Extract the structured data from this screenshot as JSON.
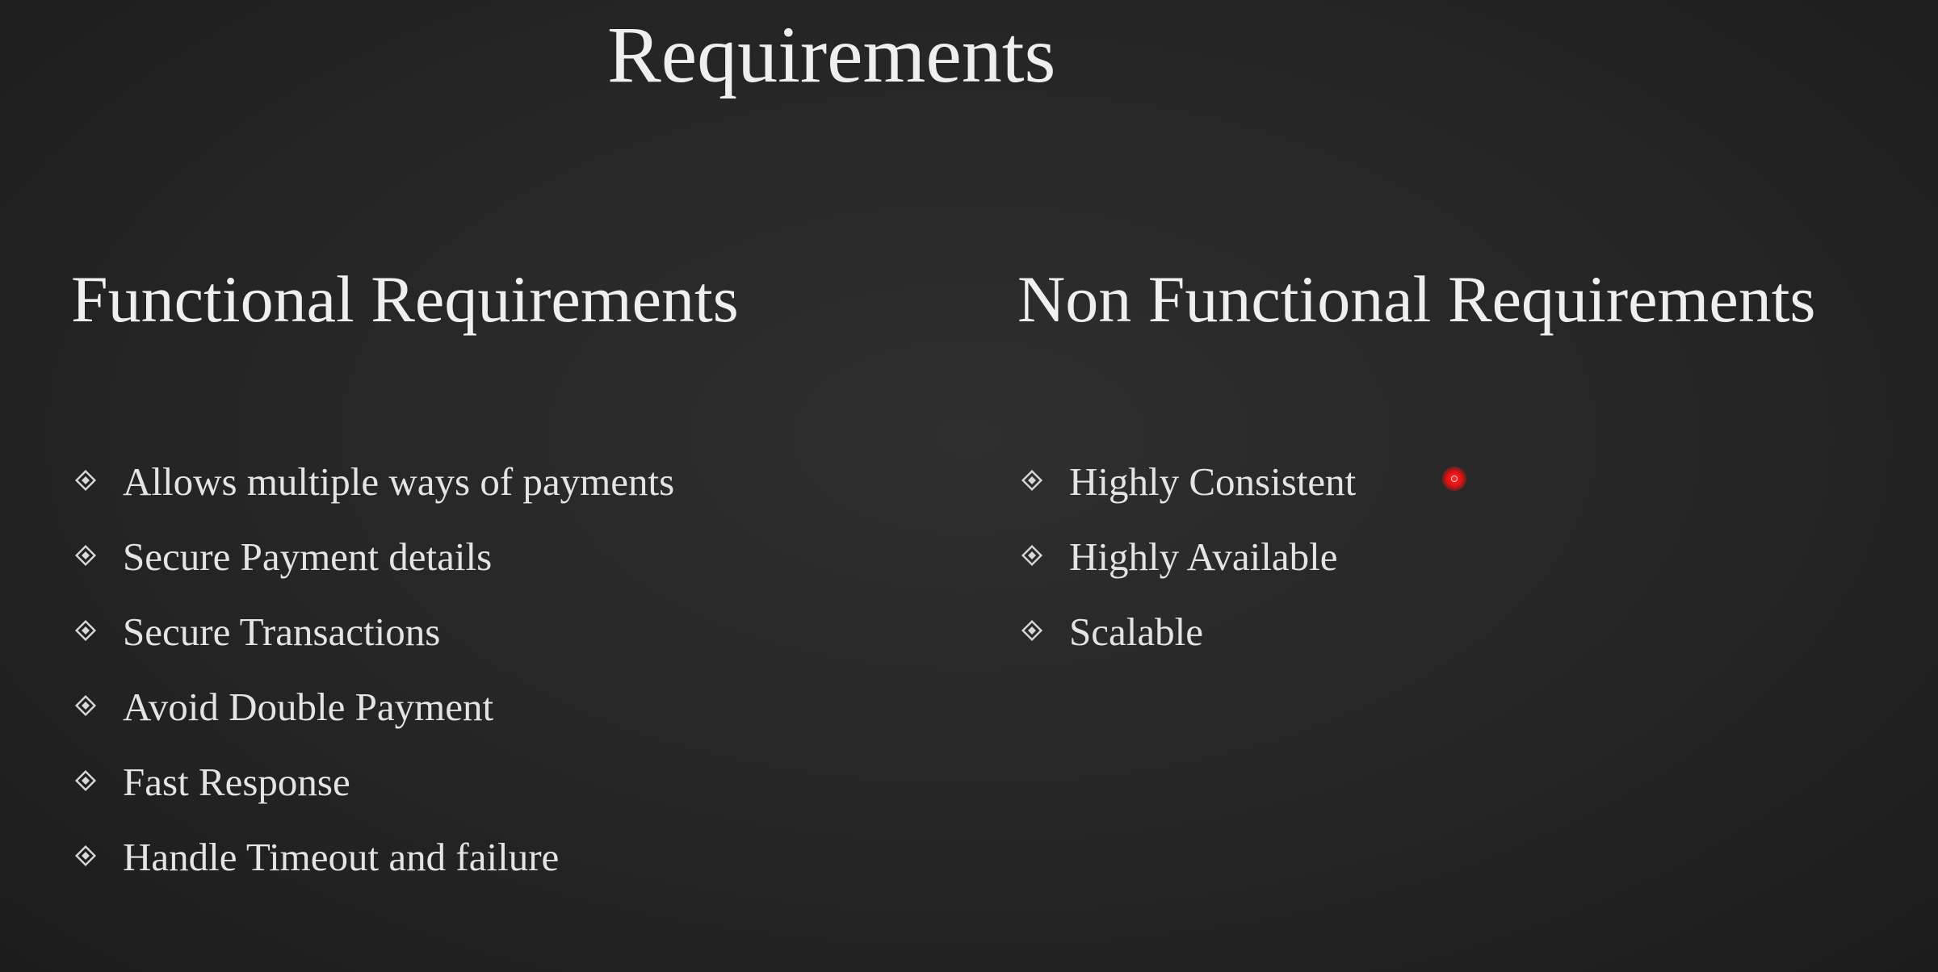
{
  "slide": {
    "title": "Requirements",
    "functional": {
      "heading": "Functional Requirements",
      "items": [
        "Allows multiple ways of payments",
        "Secure Payment details",
        "Secure Transactions",
        "Avoid Double Payment",
        "Fast Response",
        "Handle Timeout and failure"
      ]
    },
    "non_functional": {
      "heading": "Non Functional Requirements",
      "items": [
        "Highly Consistent",
        "Highly Available",
        "Scalable"
      ]
    }
  },
  "icons": {
    "bullet": "diamond-bullet-icon",
    "pointer": "laser-pointer-icon"
  },
  "colors": {
    "background": "#262626",
    "text": "#e6e6e6",
    "pointer": "#e01010"
  }
}
